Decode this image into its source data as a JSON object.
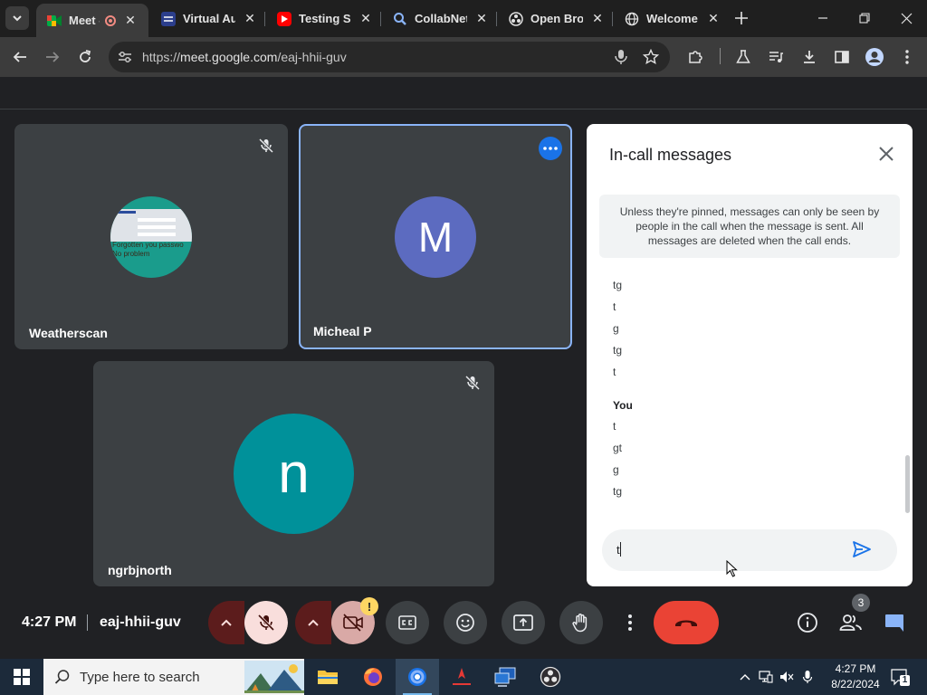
{
  "browser": {
    "tabs": [
      {
        "title": "Meet -",
        "icon": "google-meet-icon",
        "active": true,
        "recording": true
      },
      {
        "title": "Virtual Au",
        "icon": "virtual-audio-icon",
        "active": false
      },
      {
        "title": "Testing Sc",
        "icon": "youtube-icon",
        "active": false
      },
      {
        "title": "CollabNet",
        "icon": "search-magnifier-icon",
        "active": false
      },
      {
        "title": "Open Brou",
        "icon": "openbroadcaster-icon",
        "active": false
      },
      {
        "title": "Welcome",
        "icon": "globe-icon",
        "active": false
      }
    ],
    "url": {
      "prefix": "https://",
      "host": "meet.google.com",
      "path": "/eaj-hhii-guv"
    }
  },
  "meeting": {
    "participants": [
      {
        "name": "Weatherscan",
        "muted": true,
        "avatar_text": "",
        "avatar_thumb_lines": [
          "Forgotten you passwo",
          "No problem"
        ],
        "avatar_color": "#1a9c8c"
      },
      {
        "name": "Micheal P",
        "muted": false,
        "avatar_text": "M",
        "avatar_color": "#5c6bc0",
        "selected": true
      },
      {
        "name": "ngrbjnorth",
        "muted": true,
        "avatar_text": "n",
        "avatar_color": "#00919a"
      }
    ],
    "time": "4:27 PM",
    "code": "eaj-hhii-guv",
    "people_count": "3",
    "camera_warning": "!",
    "colors": {
      "hangup": "#ea4335",
      "mic_off_bg": "#f9dedc",
      "selected_border": "#8ab4f8"
    }
  },
  "chat": {
    "title": "In-call messages",
    "notice": "Unless they're pinned, messages can only be seen by people in the call when the message is sent. All messages are deleted when the call ends.",
    "messages_others": [
      "tg",
      "t",
      "g",
      "tg",
      "t"
    ],
    "you_label": "You",
    "messages_you": [
      "t",
      "gt",
      "g",
      "tg"
    ],
    "input_value": "t"
  },
  "taskbar": {
    "search_placeholder": "Type here to search",
    "time": "4:27 PM",
    "date": "8/22/2024",
    "notification_count": "1"
  }
}
